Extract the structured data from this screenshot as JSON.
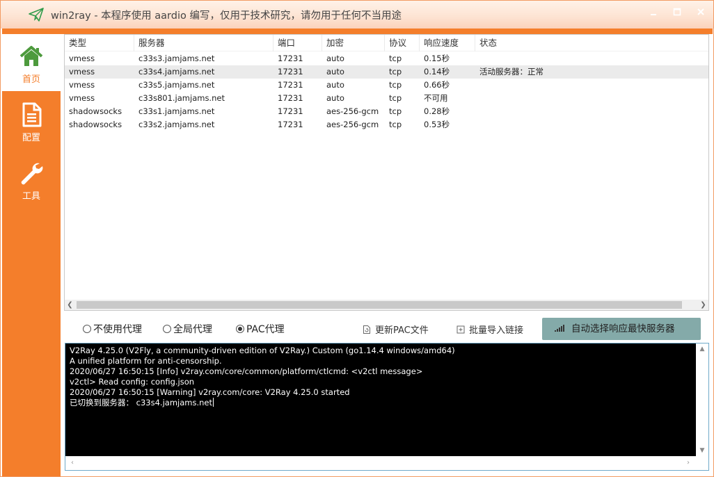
{
  "window": {
    "title": "win2ray - 本程序使用 aardio 编写，仅用于技术研究，请勿用于任何不当用途",
    "app_icon": "paper-plane-icon",
    "buttons": [
      "minimize-icon",
      "maximize-icon",
      "close-icon"
    ]
  },
  "colors": {
    "accent": "#f47e2b",
    "auto_button": "#84aaa9",
    "console_bg": "#000000"
  },
  "sidebar": {
    "items": [
      {
        "label": "首页",
        "icon": "home-icon",
        "active": true
      },
      {
        "label": "配置",
        "icon": "document-icon",
        "active": false
      },
      {
        "label": "工具",
        "icon": "wrench-icon",
        "active": false
      }
    ]
  },
  "server_list": {
    "columns": [
      "类型",
      "服务器",
      "端口",
      "加密",
      "协议",
      "响应速度",
      "状态"
    ],
    "rows": [
      {
        "type": "vmess",
        "server": "c33s3.jamjams.net",
        "port": "17231",
        "encryption": "auto",
        "protocol": "tcp",
        "speed": "0.15秒",
        "status": ""
      },
      {
        "type": "vmess",
        "server": "c33s4.jamjams.net",
        "port": "17231",
        "encryption": "auto",
        "protocol": "tcp",
        "speed": "0.14秒",
        "status": "活动服务器：正常"
      },
      {
        "type": "vmess",
        "server": "c33s5.jamjams.net",
        "port": "17231",
        "encryption": "auto",
        "protocol": "tcp",
        "speed": "0.66秒",
        "status": ""
      },
      {
        "type": "vmess",
        "server": "c33s801.jamjams.net",
        "port": "17231",
        "encryption": "auto",
        "protocol": "tcp",
        "speed": "不可用",
        "status": ""
      },
      {
        "type": "shadowsocks",
        "server": "c33s1.jamjams.net",
        "port": "17231",
        "encryption": "aes-256-gcm",
        "protocol": "tcp",
        "speed": "0.28秒",
        "status": ""
      },
      {
        "type": "shadowsocks",
        "server": "c33s2.jamjams.net",
        "port": "17231",
        "encryption": "aes-256-gcm",
        "protocol": "tcp",
        "speed": "0.53秒",
        "status": ""
      }
    ],
    "selected_index": 1
  },
  "proxy_modes": {
    "options": [
      "不使用代理",
      "全局代理",
      "PAC代理"
    ],
    "selected": "PAC代理"
  },
  "toolbar": {
    "update_pac": "更新PAC文件",
    "batch_import": "批量导入链接",
    "auto_select": "自动选择响应最快服务器"
  },
  "console": {
    "lines": [
      "V2Ray 4.25.0 (V2Fly, a community-driven edition of V2Ray.) Custom (go1.14.4 windows/amd64)",
      "A unified platform for anti-censorship.",
      "2020/06/27 16:50:15 [Info] v2ray.com/core/common/platform/ctlcmd: <v2ctl message>",
      "v2ctl> Read config:  config.json",
      "2020/06/27 16:50:15 [Warning] v2ray.com/core: V2Ray 4.25.0 started",
      "已切换到服务器：   c33s4.jamjams.net"
    ]
  }
}
